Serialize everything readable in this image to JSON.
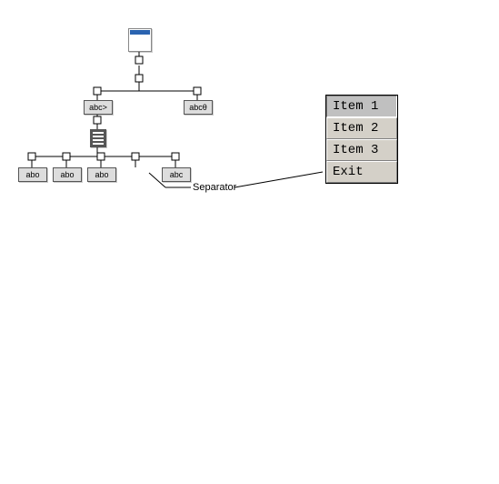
{
  "tree": {
    "level2_left_label": "abc>",
    "level2_right_label": "abcθ",
    "leaf_labels": [
      "abo",
      "abo",
      "abo",
      "abc"
    ]
  },
  "annotation": {
    "separator_label": "Separator"
  },
  "menu": {
    "items": [
      {
        "label": "Item 1",
        "selected": true
      },
      {
        "label": "Item 2",
        "selected": false
      },
      {
        "label": "Item 3",
        "selected": false
      },
      {
        "label": "Exit",
        "selected": false
      }
    ]
  }
}
